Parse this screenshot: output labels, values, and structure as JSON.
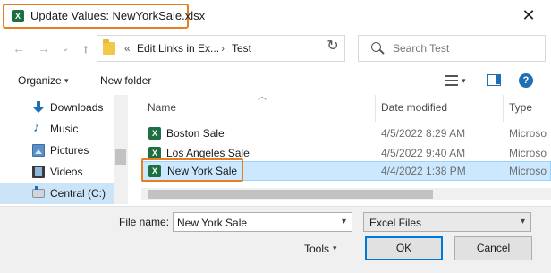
{
  "window": {
    "title_prefix": "Update Values: ",
    "title_file": "NewYorkSale.xlsx",
    "close_label": "✕"
  },
  "navbar": {
    "back": "←",
    "forward": "→",
    "recent": "⌄",
    "up": "↑",
    "crumb_sep": "«",
    "crumbs": [
      "Edit Links in Ex...",
      "Test"
    ],
    "crumb_arrow": "›",
    "refresh": "↻",
    "search_placeholder": "Search Test"
  },
  "toolbar": {
    "organize": "Organize",
    "new_folder": "New folder"
  },
  "nav_pane": {
    "items": [
      {
        "label": "Downloads",
        "icon": "download-icon"
      },
      {
        "label": "Music",
        "icon": "music-icon"
      },
      {
        "label": "Pictures",
        "icon": "pictures-icon"
      },
      {
        "label": "Videos",
        "icon": "videos-icon"
      },
      {
        "label": "Central (C:)",
        "icon": "drive-icon",
        "selected": true
      }
    ]
  },
  "file_list": {
    "columns": [
      "Name",
      "Date modified",
      "Type"
    ],
    "rows": [
      {
        "name": "Boston Sale",
        "date": "4/5/2022 8:29 AM",
        "type": "Microso"
      },
      {
        "name": "Los Angeles Sale",
        "date": "4/5/2022 9:40 AM",
        "type": "Microso"
      },
      {
        "name": "New York Sale",
        "date": "4/4/2022 1:38 PM",
        "type": "Microso",
        "selected": true
      }
    ]
  },
  "footer": {
    "file_name_label": "File name:",
    "file_name_value": "New York Sale",
    "file_type_value": "Excel Files",
    "tools_label": "Tools",
    "ok_label": "OK",
    "cancel_label": "Cancel"
  },
  "colors": {
    "highlight": "#e87e22",
    "selection": "#cce8ff",
    "excel_green": "#1d6f42",
    "accent": "#0078d7"
  }
}
